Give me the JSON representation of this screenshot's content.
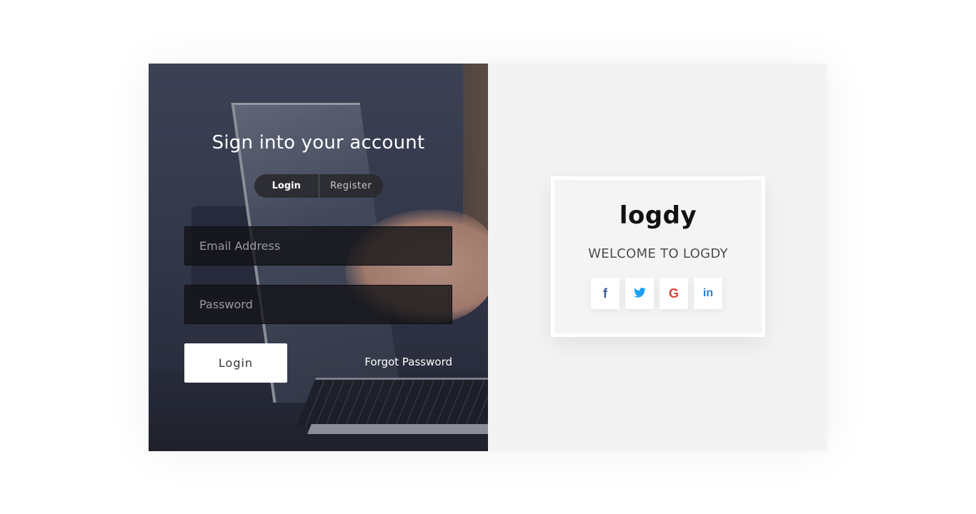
{
  "left_panel": {
    "title": "Sign into your account",
    "tabs": [
      {
        "label": "Login",
        "active": true
      },
      {
        "label": "Register",
        "active": false
      }
    ],
    "email_field": {
      "placeholder": "Email Address",
      "value": ""
    },
    "password_field": {
      "placeholder": "Password",
      "value": ""
    },
    "login_button": "Login",
    "forgot_link": "Forgot Password"
  },
  "right_panel": {
    "logo": "logdy",
    "welcome": "WELCOME TO LOGDY",
    "social_buttons": [
      {
        "icon": "facebook-icon",
        "glyph": "f",
        "color": "#3b5998"
      },
      {
        "icon": "twitter-icon",
        "glyph": "🐦",
        "color": "#1da1f2"
      },
      {
        "icon": "google-icon",
        "glyph": "G",
        "color": "#db4437"
      },
      {
        "icon": "linkedin-icon",
        "glyph": "in",
        "color": "#2a7fd6"
      }
    ]
  }
}
